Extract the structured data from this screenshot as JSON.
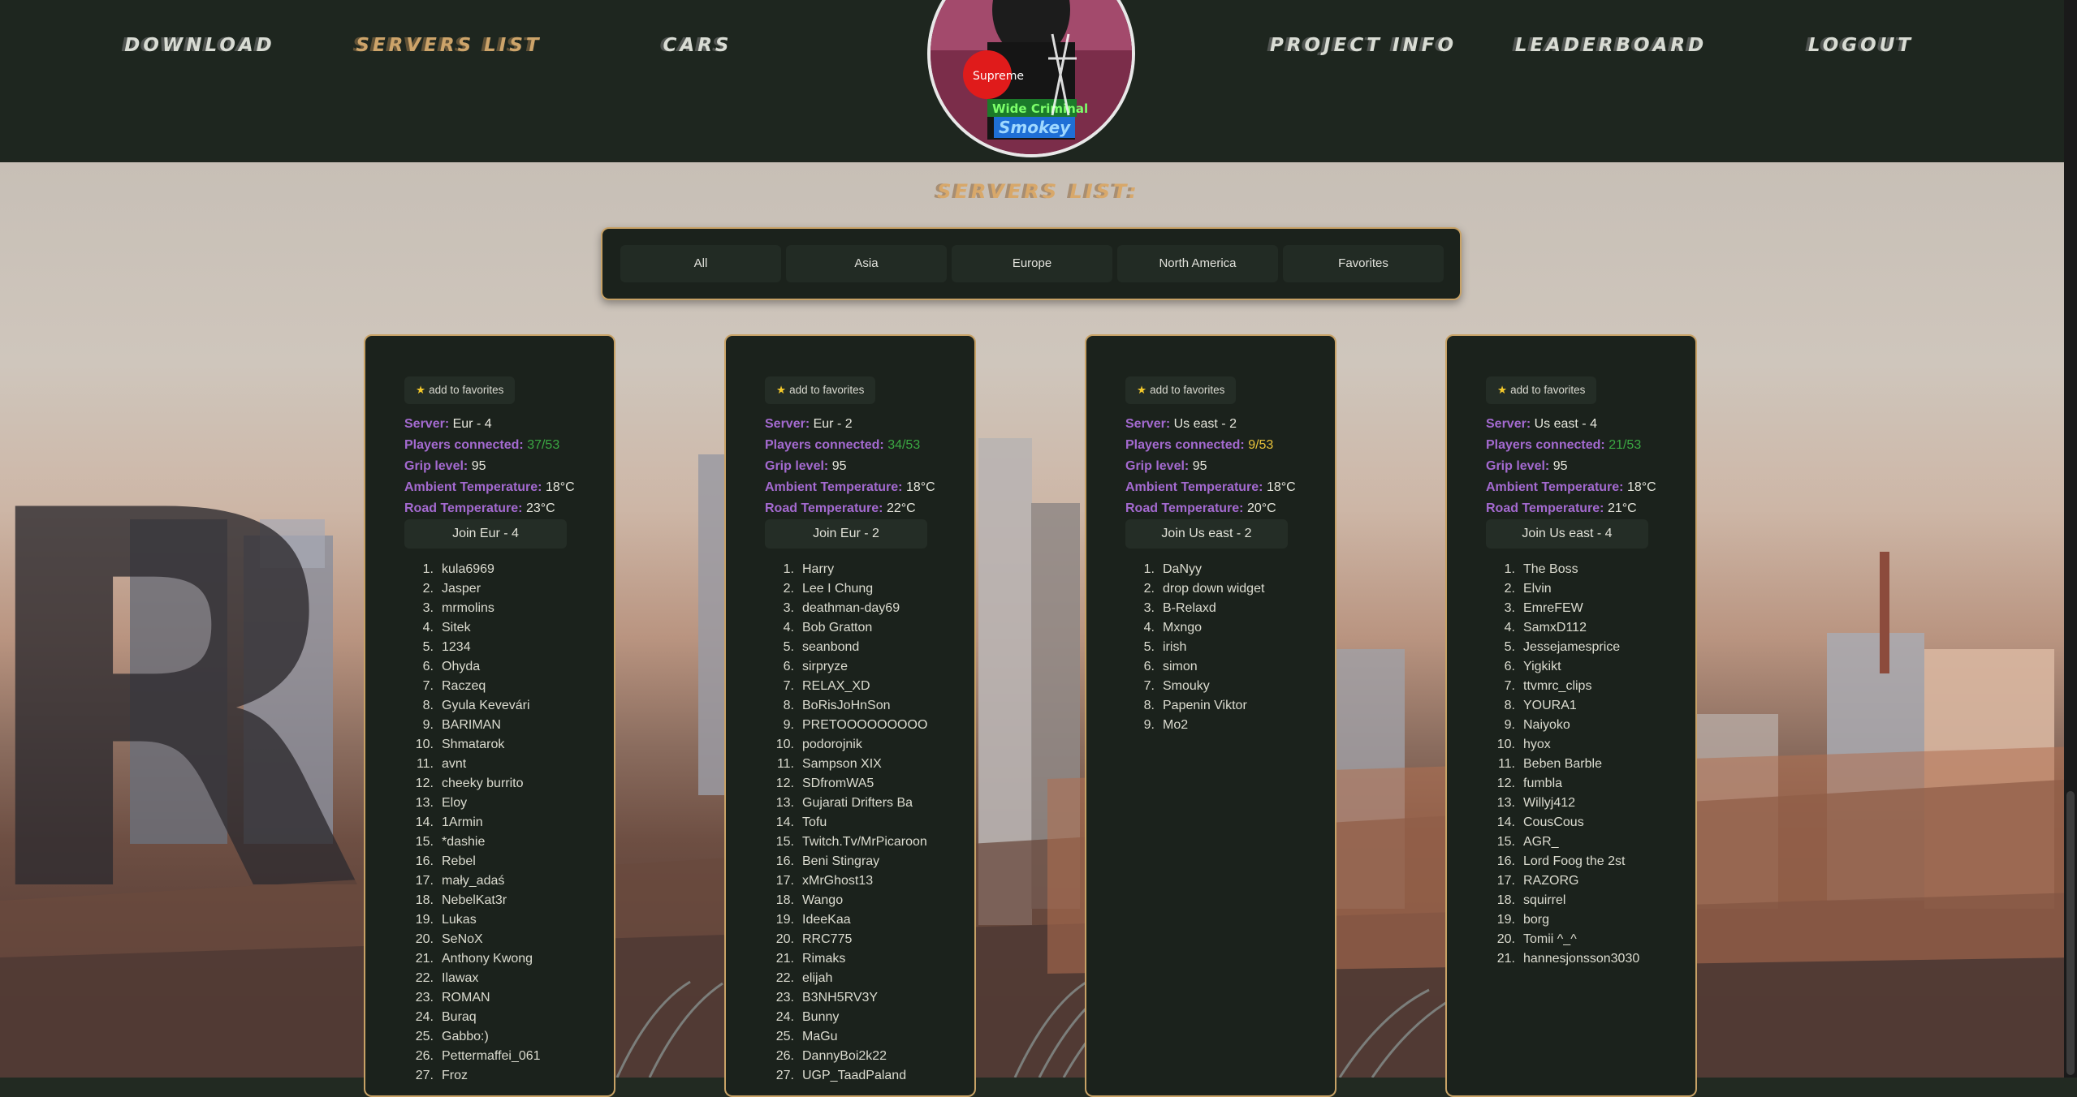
{
  "nav": {
    "items": [
      {
        "label": "DOWNLOAD"
      },
      {
        "label": "SERVERS LIST"
      },
      {
        "label": "CARS"
      },
      {
        "label": "PROJECT INFO"
      },
      {
        "label": "LEADERBOARD"
      },
      {
        "label": "LOGOUT"
      }
    ],
    "active": "SERVERS LIST",
    "avatar_text": {
      "line1": "Supreme",
      "line2": "Wide Criminal",
      "line3": "Smokey"
    }
  },
  "page": {
    "heading": "SERVERS LIST:"
  },
  "filters": [
    "All",
    "Asia",
    "Europe",
    "North America",
    "Favorites"
  ],
  "labels": {
    "favorite": "add to favorites",
    "server": "Server:",
    "players": "Players connected:",
    "grip": "Grip level:",
    "ambient": "Ambient Temperature:",
    "road": "Road Temperature:"
  },
  "colors": {
    "accent_gold": "#c8a266",
    "label_purple": "#a46ad0",
    "players_green": "#3ba843",
    "players_yellow": "#e8c23a",
    "panel_bg": "#1b221c"
  },
  "servers": [
    {
      "name": "Eur - 4",
      "players": "37/53",
      "players_status": "green",
      "grip": "95",
      "ambient": "18°C",
      "road": "23°C",
      "join": "Join Eur - 4",
      "player_list": [
        "kula6969",
        "Jasper",
        "mrmolins",
        "Sitek",
        "1234",
        "Ohyda",
        "Raczeq",
        "Gyula Kevevári",
        "BARIMAN",
        "Shmatarok",
        "avnt",
        "cheeky burrito",
        "Eloy",
        "1Armin",
        "*dashie",
        "Rebel",
        "mały_adaś",
        "NebelKat3r",
        "Lukas",
        "SeNoX",
        "Anthony Kwong",
        "Ilawax",
        "ROMAN",
        "Buraq",
        "Gabbo:)",
        "Pettermaffei_061",
        "Froz"
      ]
    },
    {
      "name": "Eur - 2",
      "players": "34/53",
      "players_status": "green",
      "grip": "95",
      "ambient": "18°C",
      "road": "22°C",
      "join": "Join Eur - 2",
      "player_list": [
        "Harry",
        "Lee I Chung",
        "deathman-day69",
        "Bob Gratton",
        "seanbond",
        "sirpryze",
        "RELAX_XD",
        "BoRisJoHnSon",
        "PRETOOOOOOOOO",
        "podorojnik",
        "Sampson XIX",
        "SDfromWA5",
        "Gujarati Drifters Ba",
        "Tofu",
        "Twitch.Tv/MrPicaroon",
        "Beni Stingray",
        "xMrGhost13",
        "Wango",
        "IdeeKaa",
        "RRC775",
        "Rimaks",
        "elijah",
        "B3NH5RV3Y",
        "Bunny",
        "MaGu",
        "DannyBoi2k22",
        "UGP_TaadPaland"
      ]
    },
    {
      "name": "Us east - 2",
      "players": "9/53",
      "players_status": "yellow",
      "grip": "95",
      "ambient": "18°C",
      "road": "20°C",
      "join": "Join Us east - 2",
      "player_list": [
        "DaNyy",
        "drop down widget",
        "B-Relaxd",
        "Mxngo",
        "irish",
        "simon",
        "Smouky",
        "Papenin Viktor",
        "Mo2"
      ]
    },
    {
      "name": "Us east - 4",
      "players": "21/53",
      "players_status": "green",
      "grip": "95",
      "ambient": "18°C",
      "road": "21°C",
      "join": "Join Us east - 4",
      "player_list": [
        "The Boss",
        "Elvin",
        "EmreFEW",
        "SamxD112",
        "Jessejamesprice",
        "Yigkikt",
        "ttvmrc_clips",
        "YOURA1",
        "Naiyoko",
        "hyox",
        "Beben Barble",
        "fumbla",
        "Willyj412",
        "CousCous",
        "AGR_",
        "Lord Foog the 2st",
        "RAZORG",
        "squirrel",
        "borg",
        "Tomii ^_^",
        "hannesjonsson3030"
      ]
    }
  ]
}
